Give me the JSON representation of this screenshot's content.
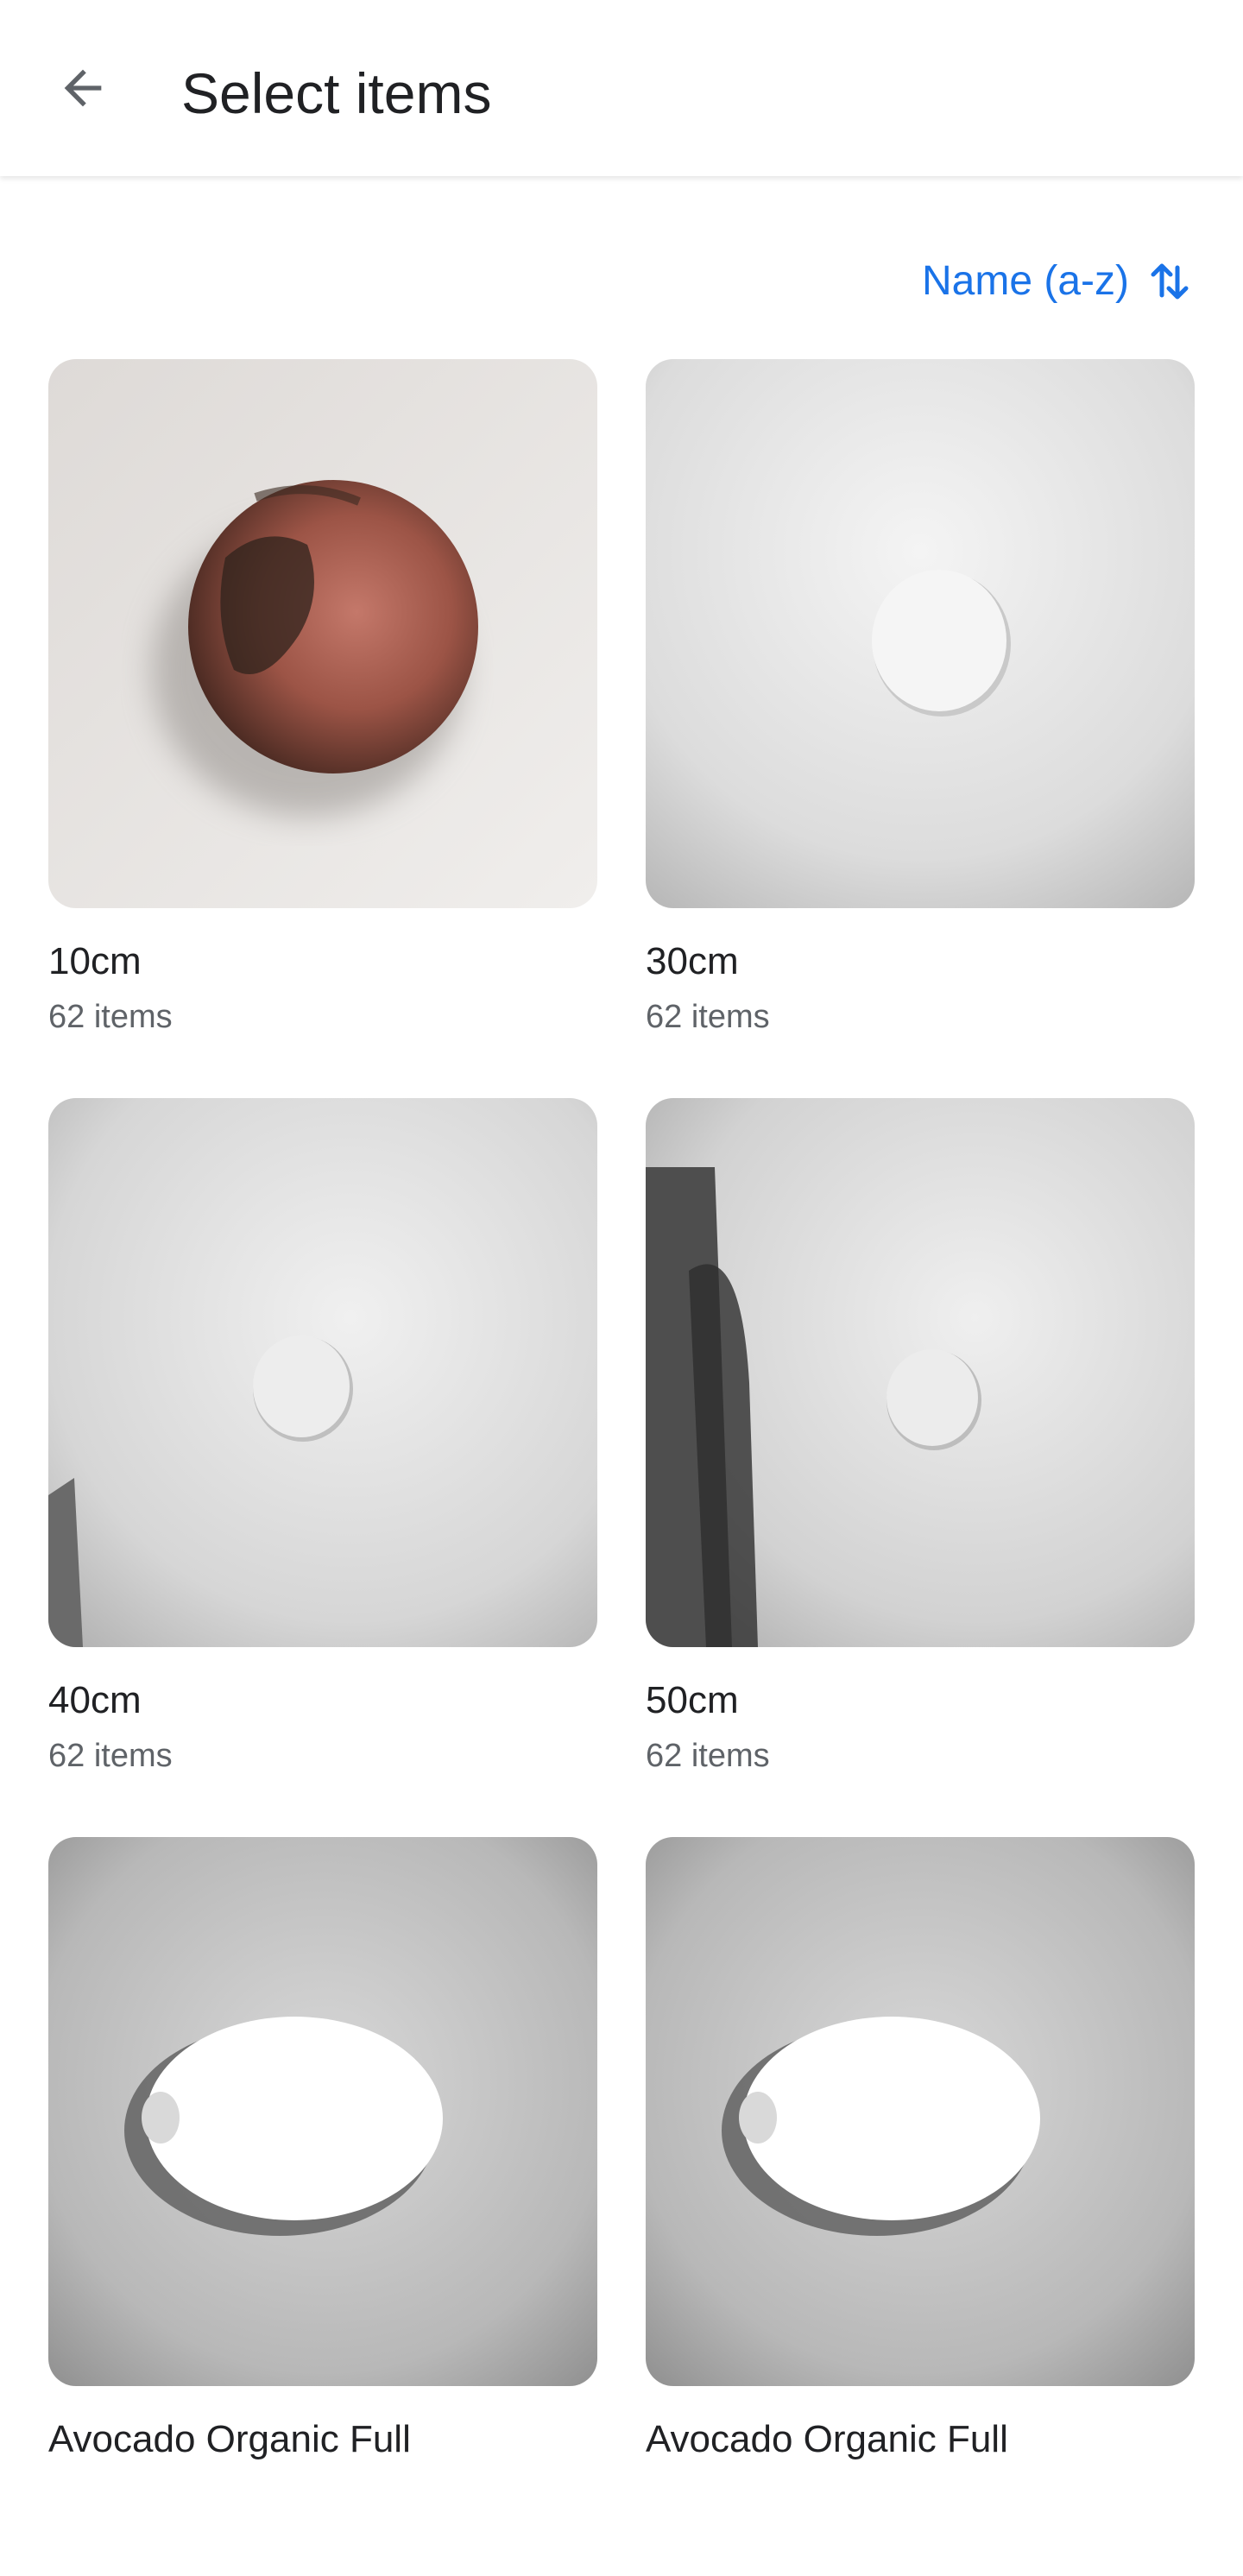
{
  "app_bar": {
    "title": "Select items",
    "back_icon": "arrow-left-icon"
  },
  "sort": {
    "label": "Name (a-z)",
    "icon": "sort-arrows-icon",
    "color": "#1a73e8"
  },
  "albums": [
    {
      "name": "10cm",
      "count": "62 items"
    },
    {
      "name": "30cm",
      "count": "62 items"
    },
    {
      "name": "40cm",
      "count": "62 items"
    },
    {
      "name": "50cm",
      "count": "62 items"
    },
    {
      "name": "Avocado Organic Full",
      "count": ""
    },
    {
      "name": "Avocado Organic Full",
      "count": ""
    }
  ]
}
